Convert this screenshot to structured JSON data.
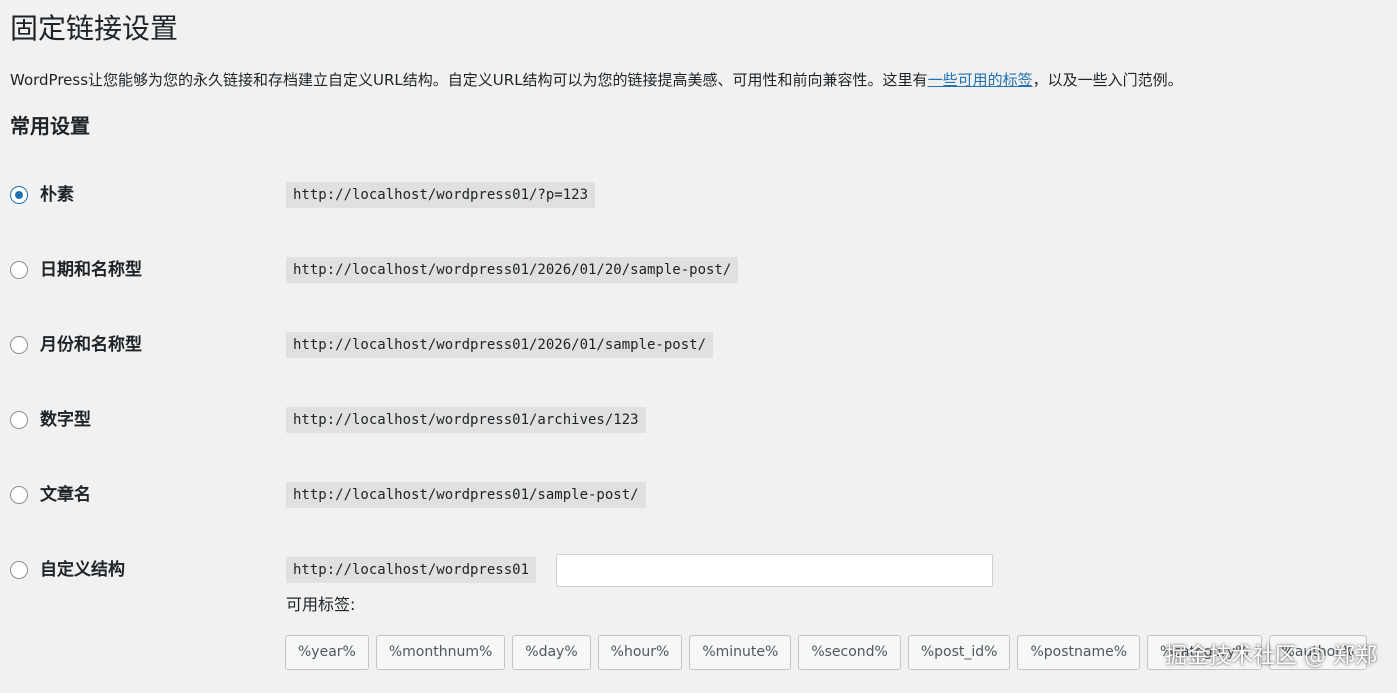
{
  "page": {
    "title": "固定链接设置",
    "intro_before": "WordPress让您能够为您的永久链接和存档建立自定义URL结构。自定义URL结构可以为您的链接提高美感、可用性和前向兼容性。这里有",
    "intro_link": "一些可用的标签",
    "intro_after": "，以及一些入门范例。",
    "section_title": "常用设置"
  },
  "options": [
    {
      "label": "朴素",
      "example": "http://localhost/wordpress01/?p=123",
      "checked": true
    },
    {
      "label": "日期和名称型",
      "example": "http://localhost/wordpress01/2026/01/20/sample-post/",
      "checked": false
    },
    {
      "label": "月份和名称型",
      "example": "http://localhost/wordpress01/2026/01/sample-post/",
      "checked": false
    },
    {
      "label": "数字型",
      "example": "http://localhost/wordpress01/archives/123",
      "checked": false
    },
    {
      "label": "文章名",
      "example": "http://localhost/wordpress01/sample-post/",
      "checked": false
    },
    {
      "label": "自定义结构",
      "example": "http://localhost/wordpress01",
      "checked": false,
      "value": ""
    }
  ],
  "available_tags_label": "可用标签:",
  "tags": [
    "%year%",
    "%monthnum%",
    "%day%",
    "%hour%",
    "%minute%",
    "%second%",
    "%post_id%",
    "%postname%",
    "%category%",
    "%author%"
  ],
  "watermark": "掘金技术社区 @ 郑郑",
  "colors": {
    "accent": "#2271b1",
    "background": "#f1f1f1",
    "code_background": "#e0e0e0"
  }
}
